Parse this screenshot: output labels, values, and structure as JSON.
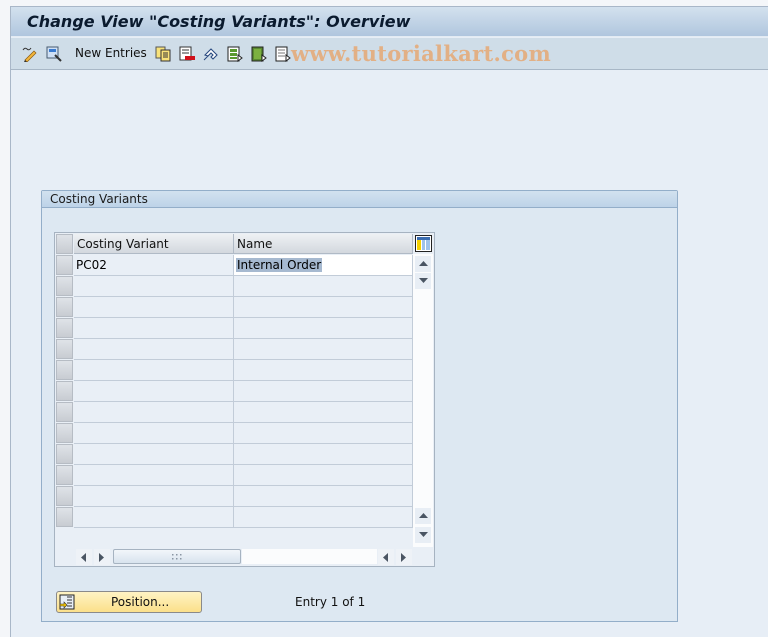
{
  "window": {
    "title": "Change View \"Costing Variants\": Overview"
  },
  "toolbar": {
    "items": [
      {
        "icon": "display-change-icon",
        "label": ""
      },
      {
        "icon": "find-icon",
        "label": ""
      },
      {
        "icon": "",
        "label": "New Entries"
      },
      {
        "icon": "copy-icon",
        "label": ""
      },
      {
        "icon": "delete-icon",
        "label": ""
      },
      {
        "icon": "undo-icon",
        "label": ""
      },
      {
        "icon": "select-all-icon",
        "label": ""
      },
      {
        "icon": "select-block-icon",
        "label": ""
      },
      {
        "icon": "deselect-all-icon",
        "label": ""
      }
    ],
    "new_entries_label": "New Entries",
    "watermark": "www.tutorialkart.com"
  },
  "group": {
    "title": "Costing Variants",
    "table": {
      "columns": [
        "Costing Variant",
        "Name"
      ],
      "rows": [
        {
          "costing_variant": "PC02",
          "name": "Internal Order"
        }
      ],
      "visible_row_count": 13,
      "settings_icon": "table-settings-icon"
    },
    "position_button": "Position...",
    "entry_info": "Entry 1 of 1"
  },
  "colors": {
    "title_bar": "#b0c6de",
    "toolbar": "#cfdde8",
    "background": "#e7eef6",
    "position_button": "#fbe08a",
    "selection": "#a6b9d0"
  }
}
